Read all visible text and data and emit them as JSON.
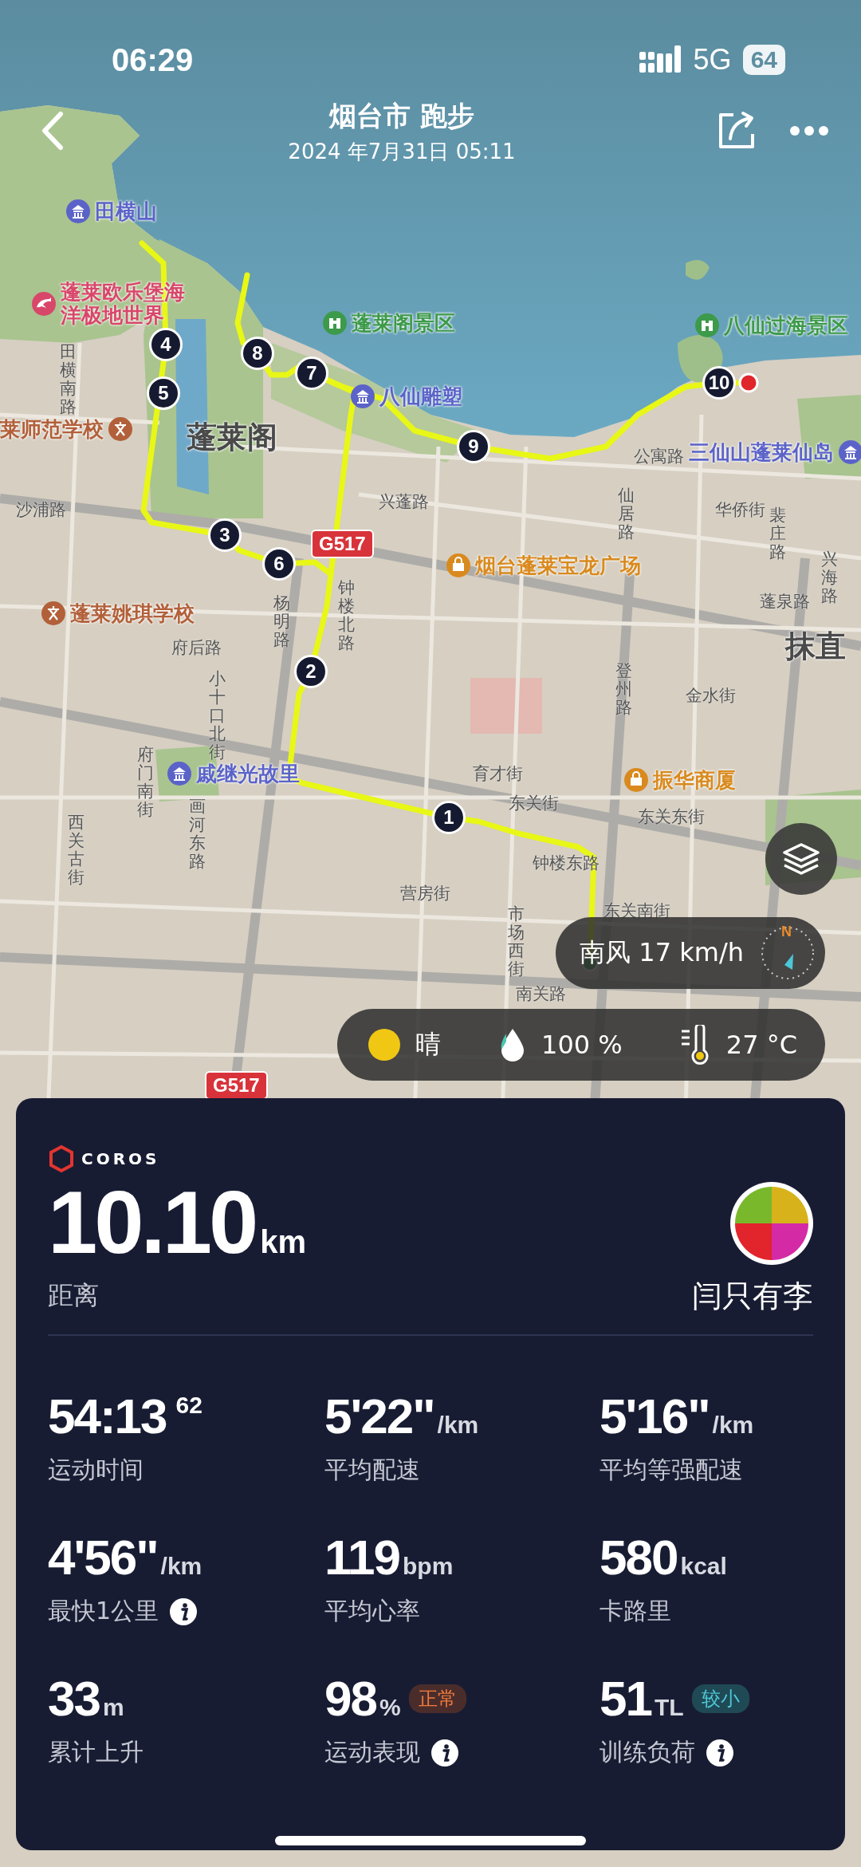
{
  "status_bar": {
    "time": "06:29",
    "network": "5G",
    "battery": "64"
  },
  "header": {
    "title": "烟台市 跑步",
    "subtitle": "2024 年7月31日 05:11"
  },
  "map": {
    "places": [
      {
        "name": "田横山",
        "kind": "sight"
      },
      {
        "name": "蓬莱欧乐堡海洋极地世界",
        "kind": "fun"
      },
      {
        "name": "蓬莱阁景区",
        "kind": "scenic"
      },
      {
        "name": "八仙雕塑",
        "kind": "sight"
      },
      {
        "name": "八仙过海景区",
        "kind": "scenic"
      },
      {
        "name": "三仙山蓬莱仙岛",
        "kind": "sight"
      },
      {
        "name": "莱师范学校",
        "kind": "school"
      },
      {
        "name": "蓬莱阁",
        "kind": "district"
      },
      {
        "name": "烟台蓬莱宝龙广场",
        "kind": "shop"
      },
      {
        "name": "蓬莱姚琪学校",
        "kind": "school"
      },
      {
        "name": "戚继光故里",
        "kind": "sight"
      },
      {
        "name": "振华商厦",
        "kind": "shop"
      },
      {
        "name": "抹直",
        "kind": "district"
      }
    ],
    "roads": [
      "沙浦路",
      "田横南路",
      "兴蓬路",
      "公寓路",
      "仙居路",
      "华侨街",
      "裴庄路",
      "府后路",
      "杨明路",
      "钟楼北路",
      "小十口北街",
      "府门南街",
      "画河东路",
      "西关古街",
      "育才街",
      "东关街",
      "东关东街",
      "钟楼东路",
      "营房街",
      "市场西街",
      "东关南街",
      "登州路",
      "金水街",
      "蓬泉路",
      "兴海路",
      "南关路"
    ],
    "highway_shields": [
      "G517",
      "G517"
    ],
    "route_markers": [
      "1",
      "2",
      "3",
      "4",
      "5",
      "6",
      "7",
      "8",
      "9",
      "10"
    ],
    "wind": {
      "text": "南风 17 km/h",
      "compass": "N"
    },
    "weather": {
      "condition": "晴",
      "humidity": "100 %",
      "temperature": "27 °C"
    }
  },
  "card": {
    "brand": "COROS",
    "distance": "10.10",
    "distance_unit": "km",
    "distance_label": "距离",
    "user_name": "闫只有李",
    "stats": [
      {
        "value": "54:13",
        "sup": "62",
        "label": "运动时间"
      },
      {
        "value": "5'22\"",
        "unit": "/km",
        "label": "平均配速"
      },
      {
        "value": "5'16\"",
        "unit": "/km",
        "label": "平均等强配速"
      },
      {
        "value": "4'56\"",
        "unit": "/km",
        "label": "最快1公里",
        "info": true
      },
      {
        "value": "119",
        "unit": "bpm",
        "label": "平均心率"
      },
      {
        "value": "580",
        "unit": "kcal",
        "label": "卡路里"
      },
      {
        "value": "33",
        "unit": "m",
        "label": "累计上升"
      },
      {
        "value": "98",
        "unit": "%",
        "label": "运动表现",
        "info": true,
        "badge": {
          "text": "正常",
          "kind": "normal"
        }
      },
      {
        "value": "51",
        "unit": "TL",
        "label": "训练负荷",
        "info": true,
        "badge": {
          "text": "较小",
          "kind": "low"
        }
      }
    ]
  }
}
